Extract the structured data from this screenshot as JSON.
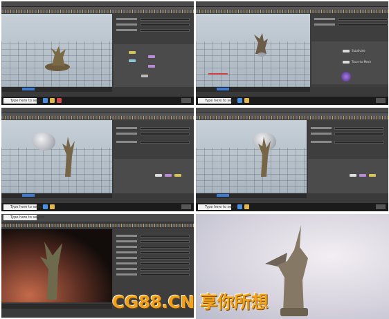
{
  "taskbar": {
    "search_placeholder": "Type here to search"
  },
  "node_labels": [
    "Subdivide",
    "Trace-to-Mesh"
  ],
  "watermark": {
    "text": "CG88.CN 享你所想"
  },
  "colors": {
    "accent_blue": "#3b7bd6",
    "node_purple": "#b98bd6",
    "node_yellow": "#d6c45a",
    "watermark": "#f0a21e"
  }
}
